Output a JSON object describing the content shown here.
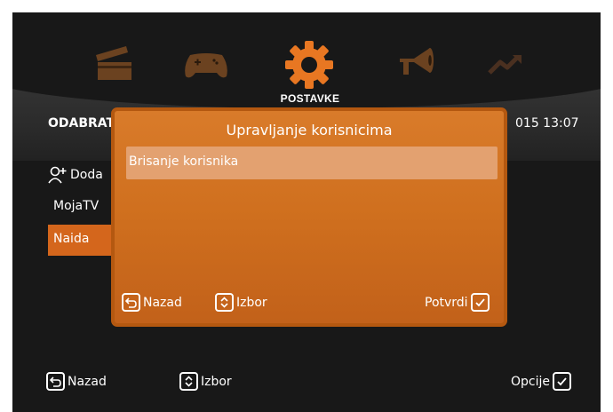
{
  "menu": {
    "icons": [
      "clapperboard-icon",
      "gamepad-icon",
      "gear-icon",
      "megaphone-icon",
      "trending-icon"
    ],
    "active_label": "POSTAVKE"
  },
  "header": {
    "title_visible": "ODABRAT",
    "datetime_visible": "015   13:07"
  },
  "user_list": {
    "items": [
      {
        "label": "Doda",
        "icon": "add-user-icon"
      },
      {
        "label": "MojaTV"
      },
      {
        "label": "Naida",
        "selected": true
      }
    ]
  },
  "dialog": {
    "title": "Upravljanje korisnicima",
    "item": "Brisanje korisnika",
    "back": "Nazad",
    "select": "Izbor",
    "confirm": "Potvrdi"
  },
  "footer": {
    "back": "Nazad",
    "select": "Izbor",
    "options": "Opcije"
  },
  "colors": {
    "accent": "#cf6f1e",
    "active_icon": "#e87722",
    "inactive_icon": "#5a3a22"
  }
}
